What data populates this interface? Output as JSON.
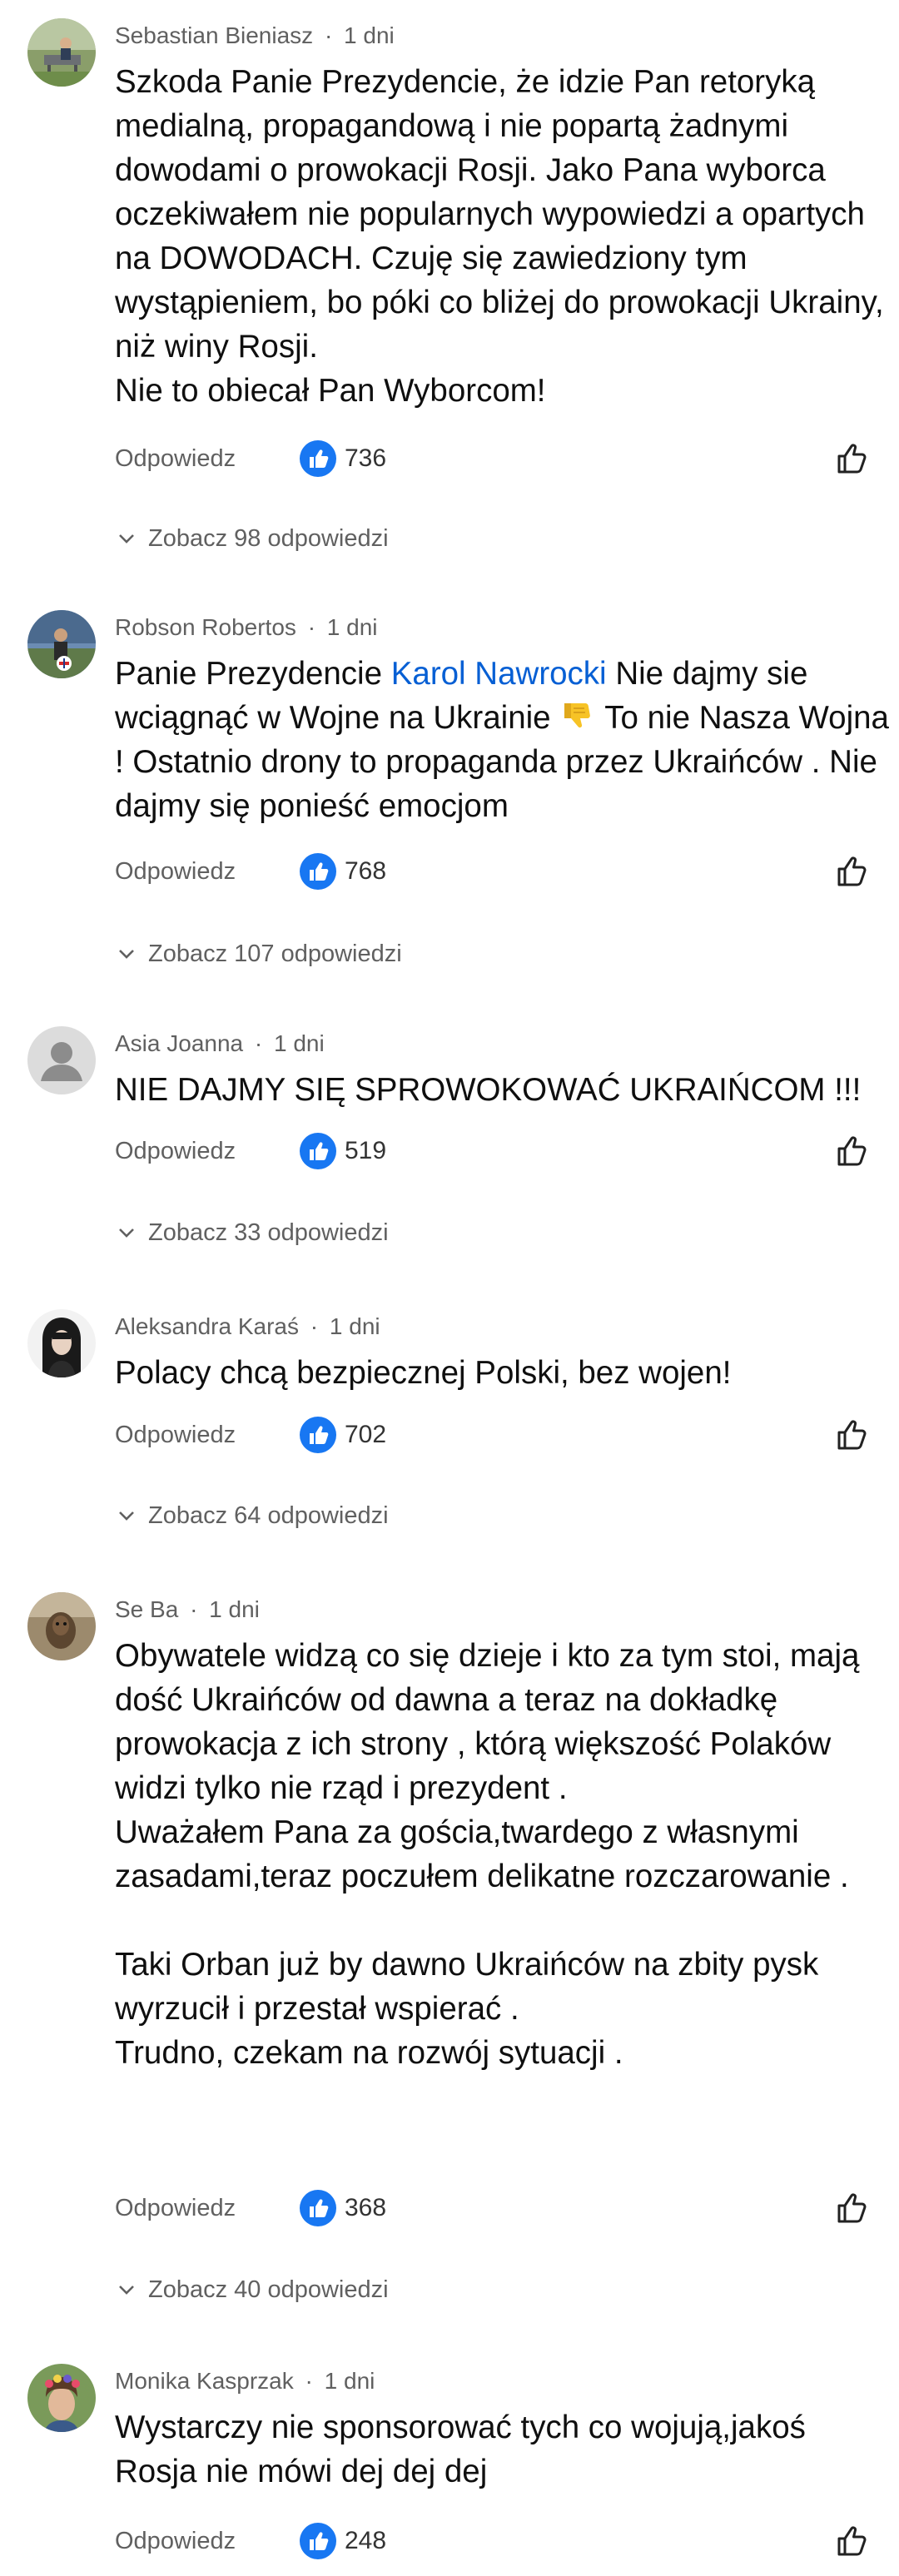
{
  "ui": {
    "reply_label": "Odpowiedz",
    "meta_separator": "·"
  },
  "colors": {
    "secondary_text": "#606060",
    "mention": "#065fd4",
    "like_badge": "#1877f2",
    "emoji_yellow": "#f7c326"
  },
  "comments": [
    {
      "author": "Sebastian Bieniasz",
      "time": "1 dni",
      "text": "Szkoda Panie Prezydencie, że idzie Pan retoryką medialną, propagandową i nie popartą żadnymi dowodami o prowokacji Rosji. Jako Pana wyborca oczekiwałem nie popularnych wypowiedzi a opartych na DOWODACH. Czuję się zawiedziony tym wystąpieniem, bo póki co bliżej do prowokacji Ukrainy, niż winy Rosji.\nNie to obiecał Pan Wyborcom!",
      "likes": "736",
      "replies_label": "Zobacz 98 odpowiedzi"
    },
    {
      "author": "Robson Robertos",
      "time": "1 dni",
      "text_before_mention": "Panie Prezydencie ",
      "mention": "Karol Nawrocki",
      "text_after_mention": " Nie dajmy sie wciągnąć w Wojne na Ukrainie ",
      "emoji_icon": "thumbs-down-emoji",
      "text_after_emoji": " To nie Nasza Wojna ! Ostatnio drony to propaganda przez Ukraińców . Nie dajmy się ponieść emocjom",
      "likes": "768",
      "replies_label": "Zobacz 107 odpowiedzi"
    },
    {
      "author": "Asia Joanna",
      "time": "1 dni",
      "text": "NIE DAJMY SIĘ SPROWOKOWAĆ UKRAIŃCOM !!!",
      "likes": "519",
      "replies_label": "Zobacz 33 odpowiedzi"
    },
    {
      "author": "Aleksandra Karaś",
      "time": "1 dni",
      "text": "Polacy chcą bezpiecznej Polski, bez wojen!",
      "likes": "702",
      "replies_label": "Zobacz 64 odpowiedzi"
    },
    {
      "author": "Se Ba",
      "time": "1 dni",
      "text": "Obywatele widzą co się dzieje i kto za tym stoi, mają dość Ukraińców od dawna a teraz na dokładkę prowokacja z ich strony , którą większość Polaków widzi tylko nie rząd i prezydent .\nUważałem Pana za gościa,twardego z własnymi zasadami,teraz poczułem delikatne rozczarowanie .\n\nTaki Orban już by dawno Ukraińców na zbity pysk wyrzucił i przestał wspierać .\nTrudno, czekam na rozwój sytuacji .",
      "likes": "368",
      "replies_label": "Zobacz 40 odpowiedzi"
    },
    {
      "author": "Monika Kasprzak",
      "time": "1 dni",
      "text": "Wystarczy nie sponsorować tych co wojują,jakoś Rosja nie mówi dej dej dej",
      "likes": "248"
    }
  ]
}
